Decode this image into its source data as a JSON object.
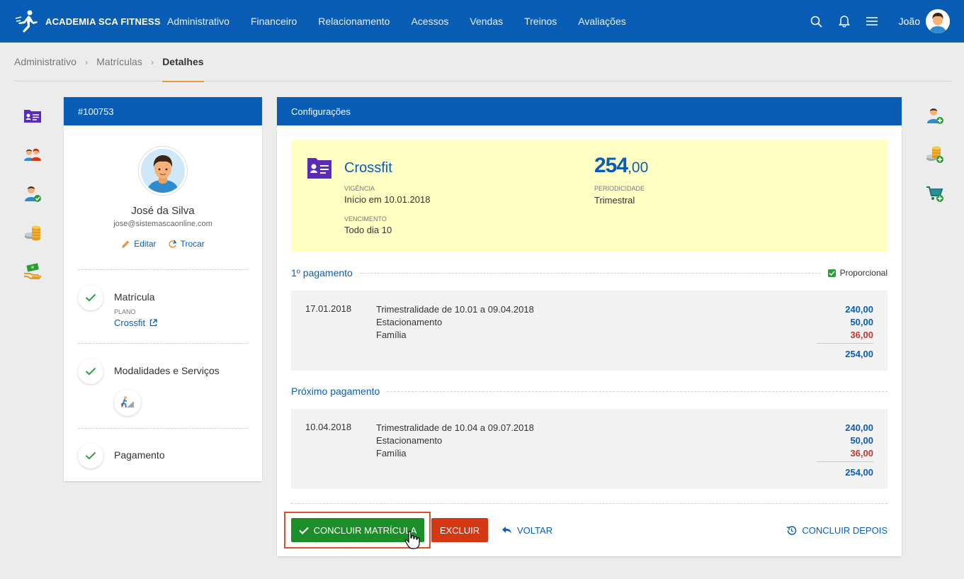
{
  "brand": {
    "name": "ACADEMIA SCA FITNESS"
  },
  "nav": {
    "items": [
      "Administrativo",
      "Financeiro",
      "Relacionamento",
      "Acessos",
      "Vendas",
      "Treinos",
      "Avaliações"
    ],
    "user": "João"
  },
  "breadcrumb": {
    "items": [
      "Administrativo",
      "Matrículas"
    ],
    "current": "Detalhes"
  },
  "member": {
    "id": "#100753",
    "name": "José da Silva",
    "email": "jose@sistemascaonline.com",
    "edit_label": "Editar",
    "swap_label": "Trocar"
  },
  "steps": {
    "matricula": {
      "title": "Matrícula",
      "sub": "PLANO",
      "link": "Crossfit"
    },
    "modalidades": {
      "title": "Modalidades e Serviços"
    },
    "pagamento": {
      "title": "Pagamento"
    }
  },
  "config": {
    "title": "Configurações",
    "plan": {
      "name": "Crossfit",
      "vigencia_label": "VIGÊNCIA",
      "vigencia": "Início em 10.01.2018",
      "vencimento_label": "VENCIMENTO",
      "vencimento": "Todo dia 10",
      "price_int": "254",
      "price_dec": ",00",
      "periodicidade_label": "PERIODICIDADE",
      "periodicidade": "Trimestral"
    },
    "first_payment": {
      "title": "1º pagamento",
      "proportional_label": "Proporcional",
      "proportional": true,
      "date": "17.01.2018",
      "lines": [
        "Trimestralidade de 10.01 a 09.04.2018",
        "Estacionamento",
        "Família"
      ],
      "values": [
        "240,00",
        "50,00",
        "36,00"
      ],
      "total": "254,00"
    },
    "next_payment": {
      "title": "Próximo pagamento",
      "date": "10.04.2018",
      "lines": [
        "Trimestralidade de 10.04 a 09.07.2018",
        "Estacionamento",
        "Família"
      ],
      "values": [
        "240,00",
        "50,00",
        "36,00"
      ],
      "total": "254,00"
    }
  },
  "actions": {
    "conclude": "CONCLUIR MATRÍCULA",
    "delete": "EXCLUIR",
    "back": "VOLTAR",
    "later": "CONCLUIR DEPOIS"
  },
  "colors": {
    "primary": "#0a5db5",
    "success": "#1b8e29",
    "danger": "#d43712",
    "highlight": "#ffffc4",
    "accent": "#e89b3a"
  }
}
